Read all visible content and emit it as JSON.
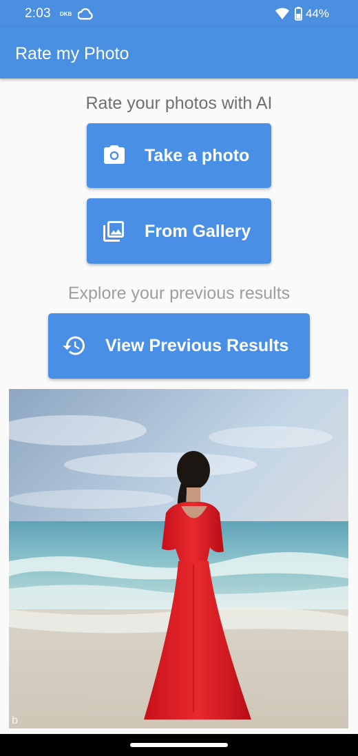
{
  "status_bar": {
    "time": "2:03",
    "dkb": "DKB",
    "battery": "44%",
    "icons": [
      "cloud-icon",
      "wifi-icon",
      "battery-icon"
    ]
  },
  "app_bar": {
    "title": "Rate my Photo",
    "color": "#4a90e2"
  },
  "main": {
    "rate_caption": "Rate your photos with AI",
    "take_photo_label": "Take a photo",
    "gallery_label": "From Gallery",
    "explore_caption": "Explore your previous results",
    "view_previous_label": "View Previous Results",
    "button_color": "#4a8fe6"
  },
  "photo": {
    "watermark": "b"
  }
}
